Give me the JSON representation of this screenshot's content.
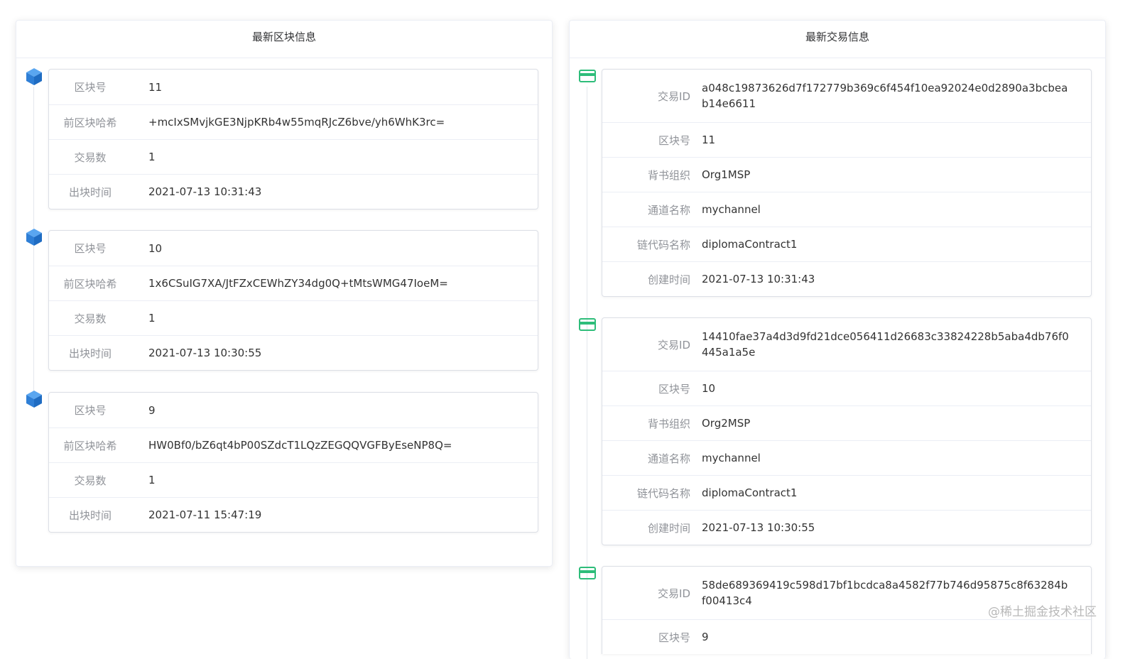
{
  "blocks_panel": {
    "title": "最新区块信息",
    "labels": {
      "number": "区块号",
      "prev_hash": "前区块哈希",
      "tx_count": "交易数",
      "time": "出块时间"
    },
    "items": [
      {
        "number": "11",
        "prev_hash": "+mcIxSMvjkGE3NjpKRb4w55mqRJcZ6bve/yh6WhK3rc=",
        "tx_count": "1",
        "time": "2021-07-13 10:31:43"
      },
      {
        "number": "10",
        "prev_hash": "1x6CSuIG7XA/JtFZxCEWhZY34dg0Q+tMtsWMG47IoeM=",
        "tx_count": "1",
        "time": "2021-07-13 10:30:55"
      },
      {
        "number": "9",
        "prev_hash": "HW0Bf0/bZ6qt4bP00SZdcT1LQzZEGQQVGFByEseNP8Q=",
        "tx_count": "1",
        "time": "2021-07-11 15:47:19"
      }
    ]
  },
  "tx_panel": {
    "title": "最新交易信息",
    "labels": {
      "tx_id": "交易ID",
      "block": "区块号",
      "org": "背书组织",
      "channel": "通道名称",
      "chaincode": "链代码名称",
      "time": "创建时间"
    },
    "items": [
      {
        "tx_id": "a048c19873626d7f172779b369c6f454f10ea92024e0d2890a3bcbeab14e6611",
        "block": "11",
        "org": "Org1MSP",
        "channel": "mychannel",
        "chaincode": "diplomaContract1",
        "time": "2021-07-13 10:31:43"
      },
      {
        "tx_id": "14410fae37a4d3d9fd21dce056411d26683c33824228b5aba4db76f0445a1a5e",
        "block": "10",
        "org": "Org2MSP",
        "channel": "mychannel",
        "chaincode": "diplomaContract1",
        "time": "2021-07-13 10:30:55"
      },
      {
        "tx_id": "58de689369419c598d17bf1bcdca8a4582f77b746d95875c8f63284bf00413c4",
        "block": "9"
      }
    ]
  },
  "watermark": "@稀土掘金技术社区",
  "colors": {
    "cube": "#3a8ee6",
    "card_icon": "#2ebd7a"
  }
}
